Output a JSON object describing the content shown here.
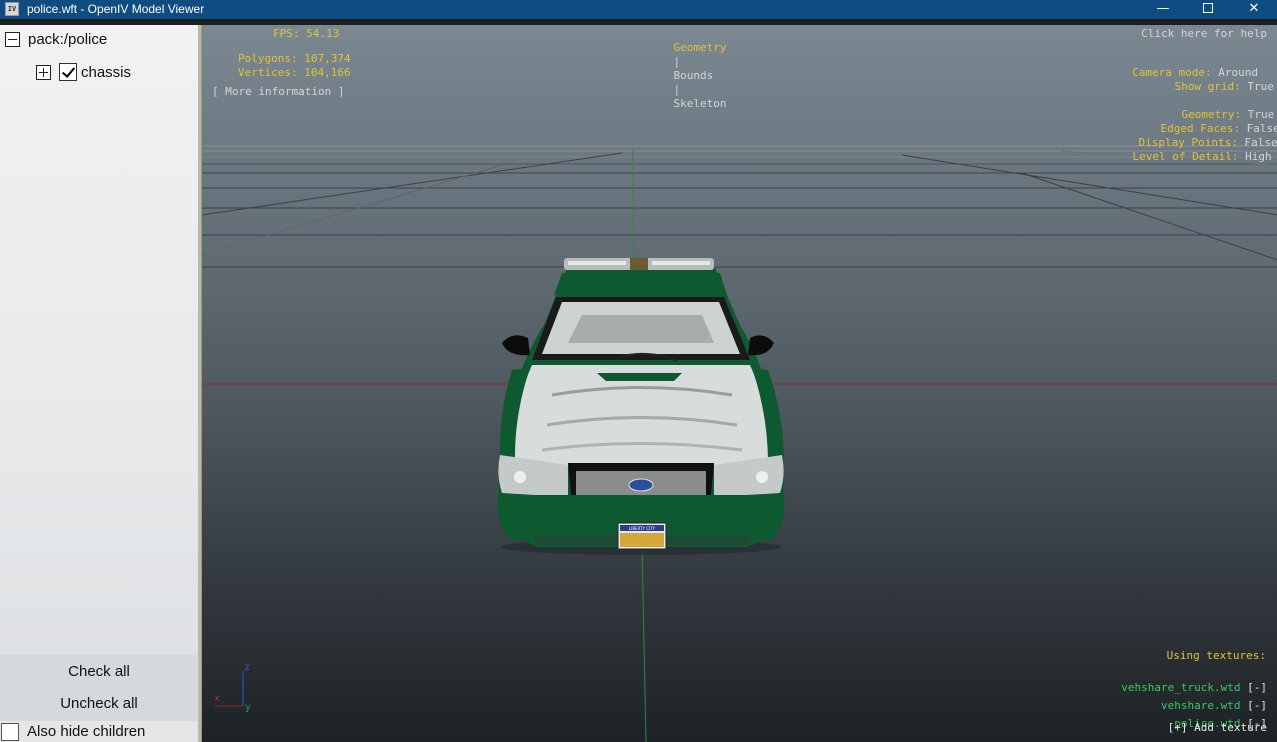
{
  "window": {
    "title": "police.wft - OpenIV Model Viewer",
    "app_icon_text": "IV",
    "minimize_glyph": "—",
    "close_glyph": "✕"
  },
  "tree": {
    "root_label": "pack:/police",
    "child_label": "chassis",
    "child_checked": true
  },
  "sidebar_buttons": {
    "check_all": "Check all",
    "uncheck_all": "Uncheck all",
    "also_hide_children": "Also hide children"
  },
  "viewport": {
    "fps": "FPS: 54.13",
    "polygons": "Polygons: 107,374",
    "vertices": "Vertices: 104,166",
    "more_info": "[ More information ]",
    "tabs": {
      "geometry": "Geometry",
      "bounds": "Bounds",
      "skeleton": "Skeleton",
      "separator": "|"
    },
    "help": "Click here for help",
    "settings": [
      {
        "label": "Camera mode:",
        "value": "Around"
      },
      {
        "label": "Show grid:",
        "value": "True"
      },
      {
        "label": "Geometry:",
        "value": "True"
      },
      {
        "label": "Edged Faces:",
        "value": "False"
      },
      {
        "label": "Display Points:",
        "value": "False"
      },
      {
        "label": "Level of Detail:",
        "value": "High"
      }
    ],
    "textures_header": "Using textures:",
    "textures": [
      {
        "name": "vehshare_truck.wtd",
        "action": "[-]"
      },
      {
        "name": "vehshare.wtd",
        "action": "[-]"
      },
      {
        "name": "police.wtd",
        "action": "[-]"
      }
    ],
    "add_texture": "[+] Add texture",
    "axes": {
      "x": "x",
      "y": "y",
      "z": "z"
    },
    "plate_text": "LIBERTY CITY"
  },
  "colors": {
    "titlebar": "#0f4c81",
    "hud_yellow": "#e3c238",
    "hud_green": "#3ec75a",
    "car_green": "#0e5a30"
  }
}
